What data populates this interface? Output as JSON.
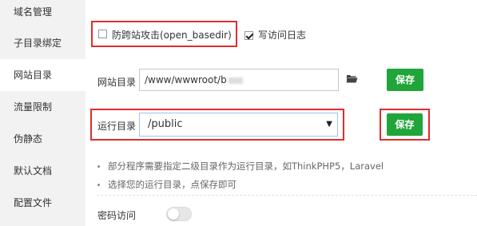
{
  "sidebar": {
    "items": [
      {
        "label": "域名管理"
      },
      {
        "label": "子目录绑定"
      },
      {
        "label": "网站目录"
      },
      {
        "label": "流量限制"
      },
      {
        "label": "伪静态"
      },
      {
        "label": "默认文档"
      },
      {
        "label": "配置文件"
      }
    ]
  },
  "options": {
    "open_basedir_label": "防跨站攻击(open_basedir)",
    "open_basedir_checked": false,
    "write_log_label": "写访问日志",
    "write_log_checked": true
  },
  "site_dir": {
    "label": "网站目录",
    "value": "/www/wwwroot/b",
    "save_label": "保存"
  },
  "run_dir": {
    "label": "运行目录",
    "value": "/public",
    "save_label": "保存"
  },
  "tips": [
    "部分程序需要指定二级目录作为运行目录，如ThinkPHP5，Laravel",
    "选择您的运行目录，点保存即可"
  ],
  "password_access": {
    "label": "密码访问",
    "enabled": false
  },
  "colors": {
    "accent_green": "#20a53a",
    "highlight_red": "#e02d2d"
  }
}
